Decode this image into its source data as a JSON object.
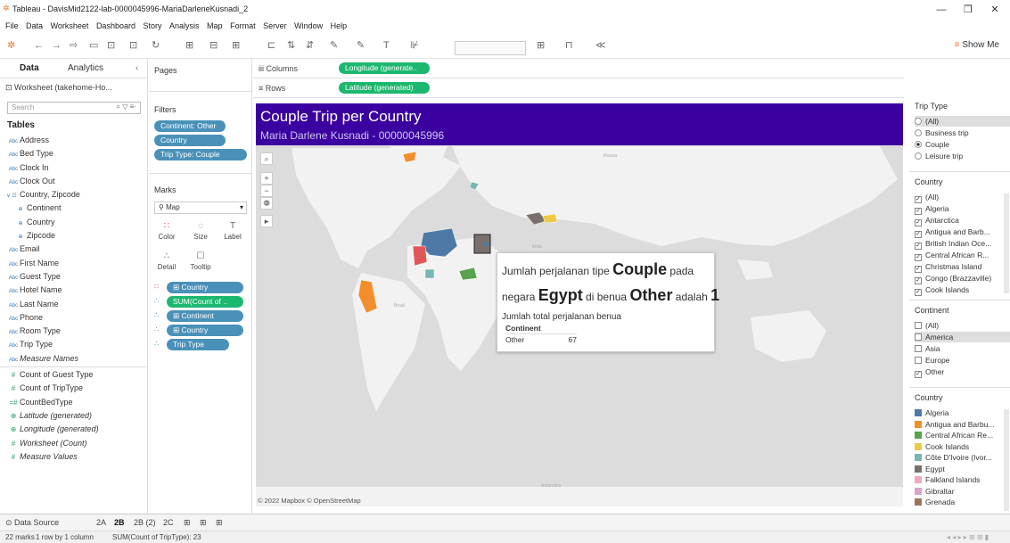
{
  "window": {
    "title": "Tableau - DavisMid2122-lab-0000045996-MariaDarleneKusnadi_2",
    "controls": [
      "—",
      "❐",
      "✕"
    ]
  },
  "menu": [
    "File",
    "Data",
    "Worksheet",
    "Dashboard",
    "Story",
    "Analysis",
    "Map",
    "Format",
    "Server",
    "Window",
    "Help"
  ],
  "toolbar": {
    "show_me_label": "Show Me"
  },
  "data_pane": {
    "tab_data": "Data",
    "tab_analytics": "Analytics",
    "source": "Worksheet (takehome-Ho...",
    "search_placeholder": "Search",
    "tables_header": "Tables",
    "fields": [
      {
        "icon": "Abc",
        "label": "Address",
        "kind": "dim"
      },
      {
        "icon": "Abc",
        "label": "Bed Type",
        "kind": "dim"
      },
      {
        "icon": "Abc",
        "label": "Clock In",
        "kind": "dim"
      },
      {
        "icon": "Abc",
        "label": "Clock Out",
        "kind": "dim"
      },
      {
        "icon": "∨ ☷",
        "label": "Country, Zipcode",
        "kind": "hier"
      },
      {
        "icon": "⊕",
        "label": "Continent",
        "kind": "geo"
      },
      {
        "icon": "⊕",
        "label": "Country",
        "kind": "geo"
      },
      {
        "icon": "⊕",
        "label": "Zipcode",
        "kind": "geo"
      },
      {
        "icon": "Abc",
        "label": "Email",
        "kind": "dim"
      },
      {
        "icon": "Abc",
        "label": "First Name",
        "kind": "dim"
      },
      {
        "icon": "Abc",
        "label": "Guest Type",
        "kind": "dim"
      },
      {
        "icon": "Abc",
        "label": "Hotel Name",
        "kind": "dim"
      },
      {
        "icon": "Abc",
        "label": "Last Name",
        "kind": "dim"
      },
      {
        "icon": "Abc",
        "label": "Phone",
        "kind": "dim"
      },
      {
        "icon": "Abc",
        "label": "Room Type",
        "kind": "dim"
      },
      {
        "icon": "Abc",
        "label": "Trip Type",
        "kind": "dim"
      },
      {
        "icon": "Abc",
        "label": "Measure Names",
        "kind": "dim-ital"
      },
      {
        "icon": "#",
        "label": "Count of Guest Type",
        "kind": "meas"
      },
      {
        "icon": "#",
        "label": "Count of TripType",
        "kind": "meas"
      },
      {
        "icon": "=#",
        "label": "CountBedType",
        "kind": "meas"
      },
      {
        "icon": "⊕",
        "label": "Latitude (generated)",
        "kind": "meas-ital"
      },
      {
        "icon": "⊕",
        "label": "Longitude (generated)",
        "kind": "meas-ital"
      },
      {
        "icon": "#",
        "label": "Worksheet (Count)",
        "kind": "meas-ital"
      },
      {
        "icon": "#",
        "label": "Measure Values",
        "kind": "meas-ital"
      }
    ]
  },
  "pages": {
    "header": "Pages"
  },
  "filters": {
    "header": "Filters",
    "pills": [
      "Continent: Other",
      "Country",
      "Trip Type: Couple"
    ]
  },
  "marks": {
    "header": "Marks",
    "type": "Map",
    "buttons": [
      {
        "icon": "∷",
        "label": "Color"
      },
      {
        "icon": "◌",
        "label": "Size"
      },
      {
        "icon": "T",
        "label": "Label"
      },
      {
        "icon": "∴",
        "label": "Detail"
      },
      {
        "icon": "☐",
        "label": "Tooltip"
      }
    ],
    "rows": [
      {
        "icon": "∷",
        "label": "⊞ Country",
        "color": "blue"
      },
      {
        "icon": "∴",
        "label": "SUM(Count of ..",
        "color": "green"
      },
      {
        "icon": "∴",
        "label": "⊞ Continent",
        "color": "blue"
      },
      {
        "icon": "∴",
        "label": "⊞ Country",
        "color": "blue"
      },
      {
        "icon": "∴",
        "label": "Trip Type",
        "color": "blue"
      }
    ]
  },
  "shelves": {
    "columns_label": "iii Columns",
    "columns_pill": "Longitude (generate..",
    "rows_label": "≡ Rows",
    "rows_pill": "Latitude (generated)"
  },
  "viz": {
    "title": "Couple Trip per Country",
    "subtitle": "Maria Darlene Kusnadi - 00000045996",
    "attribution": "© 2022 Mapbox © OpenStreetMap",
    "map_controls": [
      "⌕",
      "+",
      "−",
      "❁",
      "▸"
    ],
    "tooltip": {
      "l1_a": "Jumlah perjalanan tipe ",
      "l1_b": "Couple",
      "l1_c": " pada",
      "l2_a": "negara ",
      "l2_b": "Egypt",
      "l2_c": " di benua ",
      "l2_d": "Other",
      "l2_e": " adalah ",
      "l2_f": "1",
      "l3": "Jumlah total perjalanan benua",
      "th": "Continent",
      "row_label": "Other",
      "row_value": "67"
    },
    "colors": {
      "header_bg": "#3b00a0",
      "land": "#f2f2f2",
      "water": "#dcdcdc"
    }
  },
  "trip_type_filter": {
    "header": "Trip Type",
    "options": [
      {
        "label": "(All)",
        "selected": false,
        "hl": true
      },
      {
        "label": "Business trip",
        "selected": false,
        "hl": false
      },
      {
        "label": "Couple",
        "selected": true,
        "hl": false
      },
      {
        "label": "Leisure trip",
        "selected": false,
        "hl": false
      }
    ]
  },
  "country_filter": {
    "header": "Country",
    "options": [
      {
        "label": "(All)",
        "checked": true
      },
      {
        "label": "Algeria",
        "checked": true
      },
      {
        "label": "Antarctica",
        "checked": true
      },
      {
        "label": "Antigua and Barb...",
        "checked": true
      },
      {
        "label": "British Indian Oce...",
        "checked": true
      },
      {
        "label": "Central African R...",
        "checked": true
      },
      {
        "label": "Christmas Island",
        "checked": true
      },
      {
        "label": "Congo (Brazzaville)",
        "checked": true
      },
      {
        "label": "Cook Islands",
        "checked": true
      }
    ]
  },
  "continent_filter": {
    "header": "Continent",
    "options": [
      {
        "label": "(All)",
        "checked": false,
        "hl": false
      },
      {
        "label": "America",
        "checked": false,
        "hl": true
      },
      {
        "label": "Asia",
        "checked": false,
        "hl": false
      },
      {
        "label": "Europe",
        "checked": false,
        "hl": false
      },
      {
        "label": "Other",
        "checked": true,
        "hl": false
      }
    ]
  },
  "country_legend": {
    "header": "Country",
    "items": [
      {
        "label": "Algeria",
        "color": "#4e79a7"
      },
      {
        "label": "Antigua and Barbu...",
        "color": "#f28e2b"
      },
      {
        "label": "Central African Re...",
        "color": "#59a14f"
      },
      {
        "label": "Cook Islands",
        "color": "#edc948"
      },
      {
        "label": "Côte D'Ivoire (Ivor...",
        "color": "#76b7b2"
      },
      {
        "label": "Egypt",
        "color": "#79706e"
      },
      {
        "label": "Falkland Islands",
        "color": "#f1a7c0"
      },
      {
        "label": "Gibraltar",
        "color": "#d7a5c9"
      },
      {
        "label": "Grenada",
        "color": "#9c755f"
      }
    ]
  },
  "sheet_tabs": {
    "data_source": "Data Source",
    "tabs": [
      {
        "label": "2A",
        "active": false
      },
      {
        "label": "2B",
        "active": true
      },
      {
        "label": "2B (2)",
        "active": false
      },
      {
        "label": "2C",
        "active": false
      }
    ]
  },
  "status": {
    "marks": "22 marks",
    "rowcol": "1 row by 1 column",
    "sum": "SUM(Count of TripType): 23"
  }
}
